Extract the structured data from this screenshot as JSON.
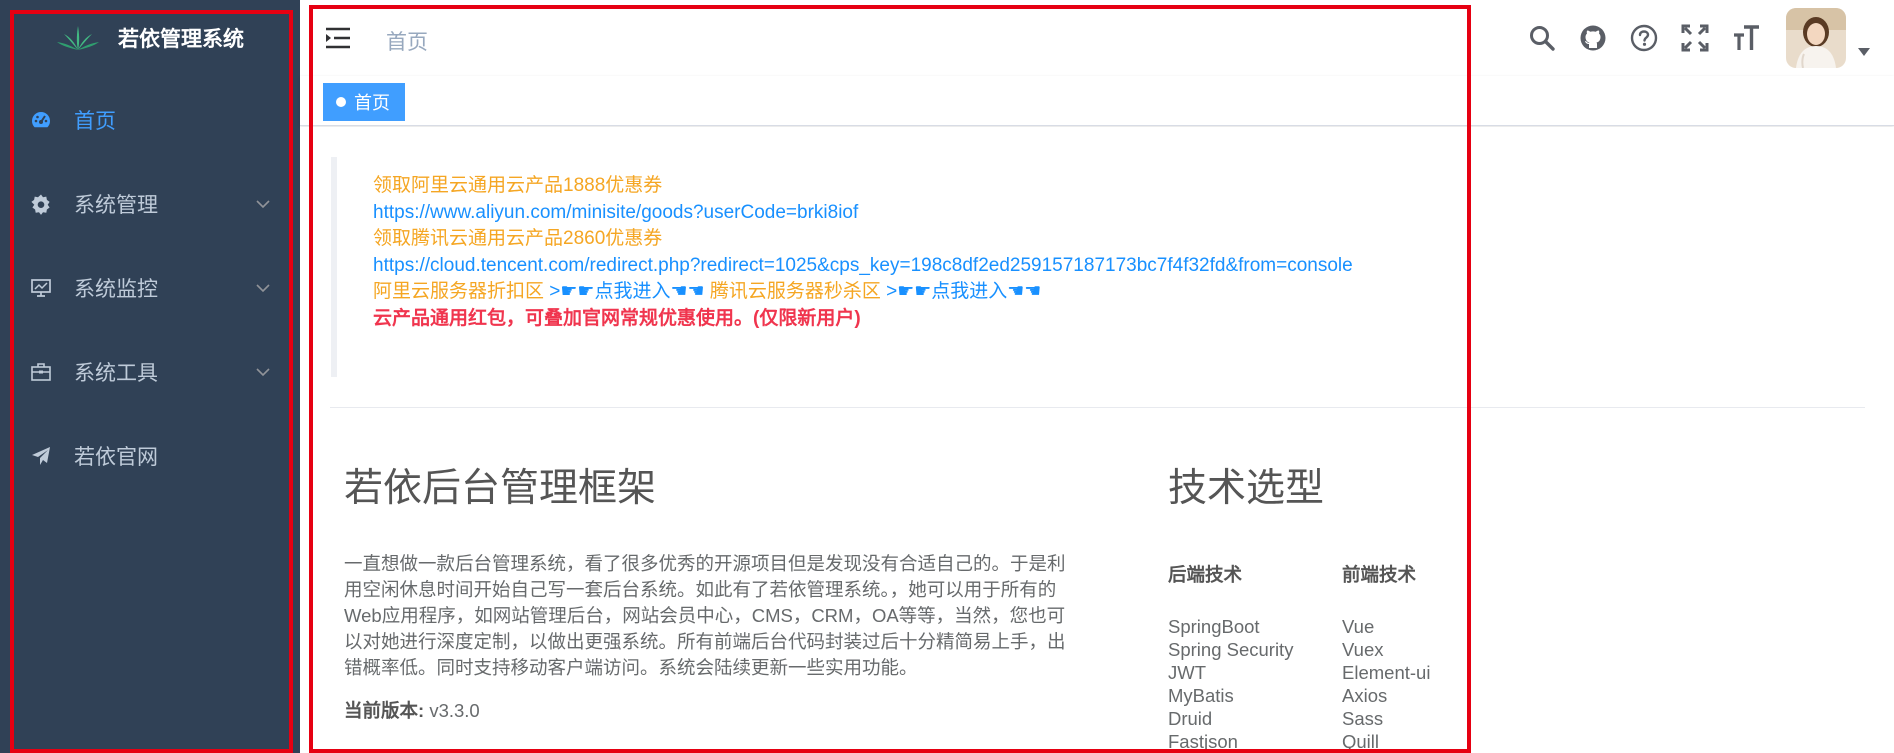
{
  "app": {
    "title": "若依管理系统"
  },
  "sidebar": {
    "items": [
      {
        "label": "首页",
        "icon": "dashboard-icon",
        "active": true,
        "has_children": false
      },
      {
        "label": "系统管理",
        "icon": "gear-icon",
        "active": false,
        "has_children": true
      },
      {
        "label": "系统监控",
        "icon": "monitor-icon",
        "active": false,
        "has_children": true
      },
      {
        "label": "系统工具",
        "icon": "toolbox-icon",
        "active": false,
        "has_children": true
      },
      {
        "label": "若依官网",
        "icon": "paper-plane-icon",
        "active": false,
        "has_children": false
      }
    ]
  },
  "navbar": {
    "breadcrumb": "首页",
    "icons": [
      "search-icon",
      "github-icon",
      "question-icon",
      "fullscreen-icon",
      "font-size-icon"
    ]
  },
  "tags": [
    {
      "label": "首页",
      "active": true
    }
  ],
  "notice": {
    "line1": "领取阿里云通用云产品1888优惠券",
    "line2": "https://www.aliyun.com/minisite/goods?userCode=brki8iof",
    "line3": "领取腾讯云通用云产品2860优惠券",
    "line4": "https://cloud.tencent.com/redirect.php?redirect=1025&cps_key=198c8df2ed259157187173bc7f4f32fd&from=console",
    "line5_a": "阿里云服务器折扣区",
    "line5_b": ">☛☛点我进入☚☚",
    "line5_c": "腾讯云服务器秒杀区",
    "line5_d": ">☛☛点我进入☚☚",
    "line6": "云产品通用红包，可叠加官网常规优惠使用。(仅限新用户)"
  },
  "intro": {
    "title": "若依后台管理框架",
    "desc": "一直想做一款后台管理系统，看了很多优秀的开源项目但是发现没有合适自己的。于是利用空闲休息时间开始自己写一套后台系统。如此有了若依管理系统。，她可以用于所有的Web应用程序，如网站管理后台，网站会员中心，CMS，CRM，OA等等，当然，您也可以对她进行深度定制，以做出更强系统。所有前端后台代码封装过后十分精简易上手，出错概率低。同时支持移动客户端访问。系统会陆续更新一些实用功能。",
    "version_label": "当前版本:",
    "version_value": "v3.3.0"
  },
  "tech": {
    "title": "技术选型",
    "backend": {
      "title": "后端技术",
      "items": [
        "SpringBoot",
        "Spring Security",
        "JWT",
        "MyBatis",
        "Druid",
        "Fastjson",
        "..."
      ]
    },
    "frontend": {
      "title": "前端技术",
      "items": [
        "Vue",
        "Vuex",
        "Element-ui",
        "Axios",
        "Sass",
        "Quill",
        "..."
      ]
    }
  },
  "colors": {
    "sidebar_bg": "#304156",
    "accent": "#409eff",
    "highlight_frame": "#e60012"
  }
}
